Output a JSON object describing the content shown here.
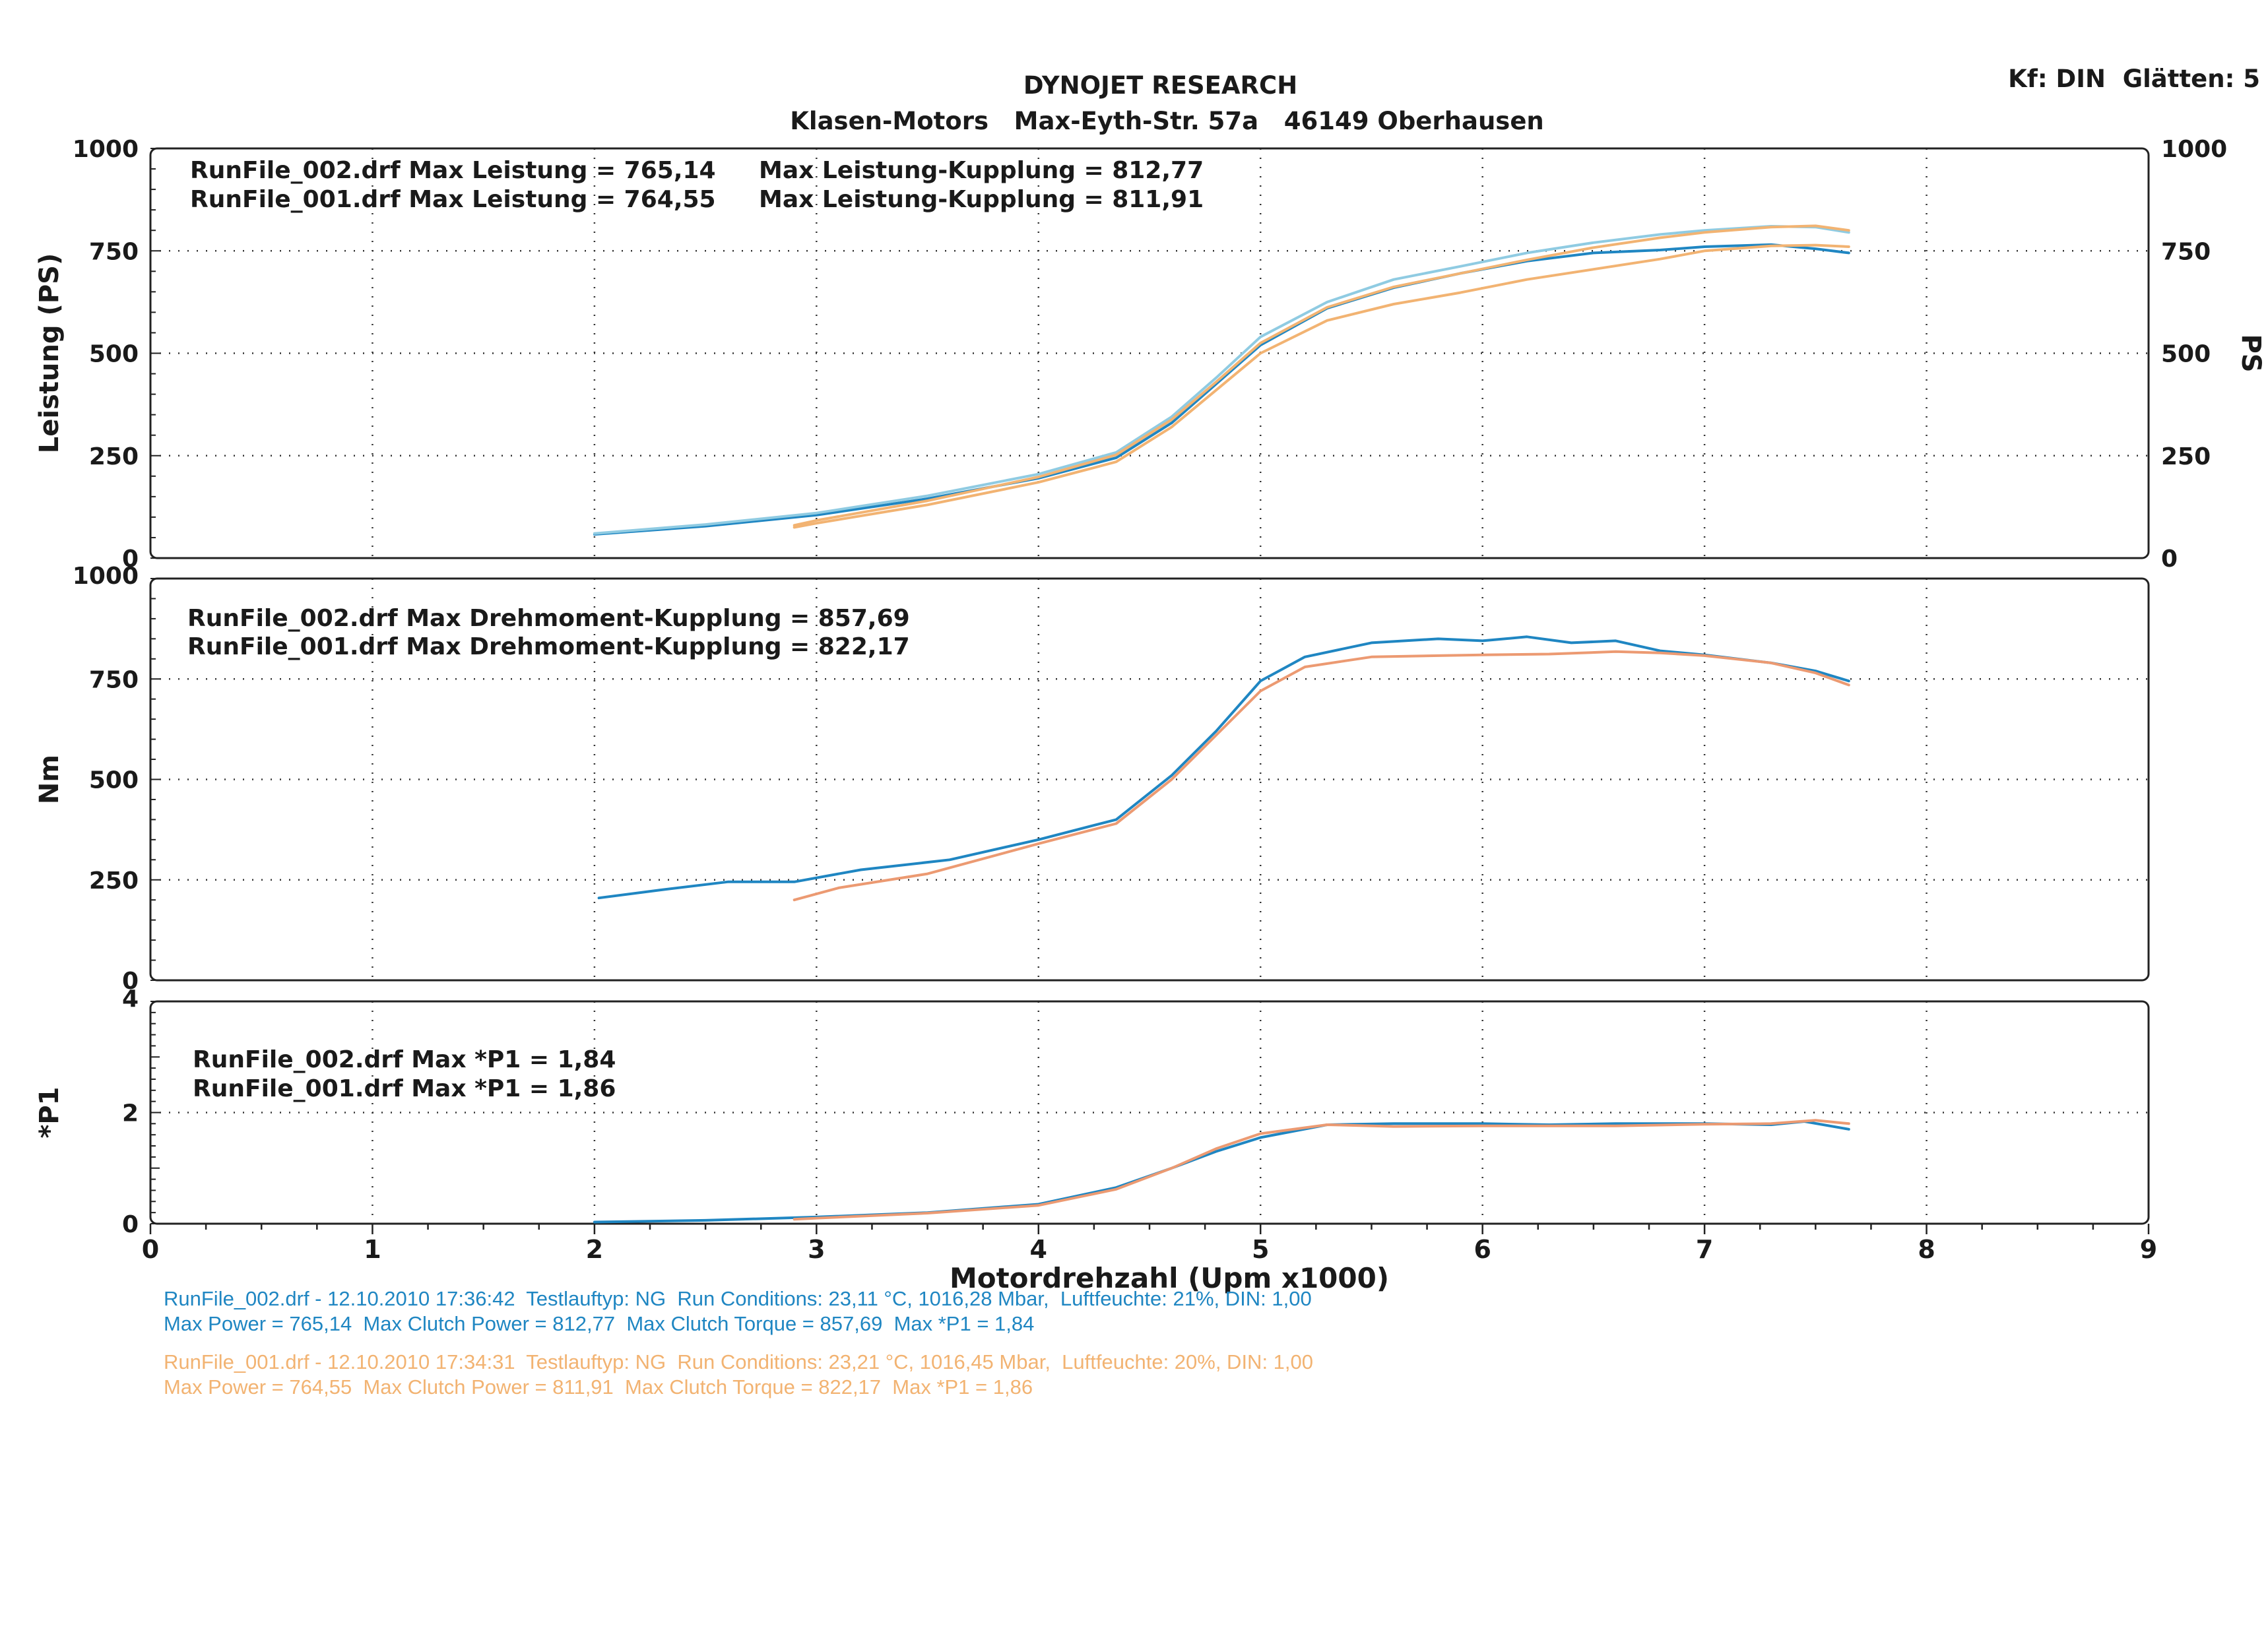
{
  "header": {
    "title": "DYNOJET RESEARCH",
    "subtitle": "Klasen-Motors   Max-Eyth-Str. 57a   46149 Oberhausen",
    "settings": "Kf: DIN  Glätten: 5"
  },
  "colors": {
    "run002": "#1f86c2",
    "run002_light": "#8fcbe2",
    "run001": "#f2b372",
    "run001_torque": "#ec9a72",
    "grid": "#333333",
    "frame": "#222222"
  },
  "chart_data": [
    {
      "type": "line",
      "panel": "power",
      "ylabel": "Leistung (PS)",
      "ylabel_right": "PS",
      "xlim": [
        0,
        9
      ],
      "ylim": [
        0,
        1000
      ],
      "yticks": [
        0,
        250,
        500,
        750,
        1000
      ],
      "grid": true,
      "annotations": [
        "RunFile_002.drf Max Leistung = 765,14",
        "Max Leistung-Kupplung = 812,77",
        "RunFile_001.drf Max Leistung = 764,55",
        "Max Leistung-Kupplung = 811,91"
      ],
      "series": [
        {
          "name": "RunFile_002.drf Leistung",
          "color_key": "run002",
          "points": [
            [
              2.0,
              58
            ],
            [
              2.5,
              78
            ],
            [
              3.0,
              105
            ],
            [
              3.5,
              145
            ],
            [
              4.0,
              195
            ],
            [
              4.35,
              245
            ],
            [
              4.6,
              330
            ],
            [
              4.8,
              425
            ],
            [
              5.0,
              520
            ],
            [
              5.3,
              610
            ],
            [
              5.6,
              660
            ],
            [
              5.9,
              695
            ],
            [
              6.2,
              725
            ],
            [
              6.5,
              745
            ],
            [
              6.8,
              752
            ],
            [
              7.0,
              760
            ],
            [
              7.3,
              765
            ],
            [
              7.5,
              755
            ],
            [
              7.65,
              745
            ]
          ]
        },
        {
          "name": "RunFile_002.drf Leistung-Kupplung",
          "color_key": "run002_light",
          "points": [
            [
              2.0,
              60
            ],
            [
              2.5,
              82
            ],
            [
              3.0,
              110
            ],
            [
              3.5,
              152
            ],
            [
              4.0,
              205
            ],
            [
              4.35,
              258
            ],
            [
              4.6,
              345
            ],
            [
              4.8,
              440
            ],
            [
              5.0,
              540
            ],
            [
              5.3,
              625
            ],
            [
              5.6,
              680
            ],
            [
              5.9,
              712
            ],
            [
              6.2,
              745
            ],
            [
              6.5,
              770
            ],
            [
              6.8,
              790
            ],
            [
              7.0,
              800
            ],
            [
              7.3,
              810
            ],
            [
              7.5,
              808
            ],
            [
              7.65,
              795
            ]
          ]
        },
        {
          "name": "RunFile_001.drf Leistung",
          "color_key": "run001",
          "points": [
            [
              2.9,
              75
            ],
            [
              3.0,
              85
            ],
            [
              3.5,
              130
            ],
            [
              4.0,
              185
            ],
            [
              4.35,
              235
            ],
            [
              4.6,
              320
            ],
            [
              4.8,
              410
            ],
            [
              5.0,
              500
            ],
            [
              5.3,
              580
            ],
            [
              5.6,
              620
            ],
            [
              5.9,
              648
            ],
            [
              6.2,
              680
            ],
            [
              6.5,
              705
            ],
            [
              6.8,
              730
            ],
            [
              7.0,
              750
            ],
            [
              7.3,
              762
            ],
            [
              7.5,
              764
            ],
            [
              7.65,
              760
            ]
          ]
        },
        {
          "name": "RunFile_001.drf Leistung-Kupplung",
          "color_key": "run001",
          "points": [
            [
              2.9,
              80
            ],
            [
              3.0,
              92
            ],
            [
              3.5,
              140
            ],
            [
              4.0,
              198
            ],
            [
              4.35,
              252
            ],
            [
              4.6,
              338
            ],
            [
              4.8,
              430
            ],
            [
              5.0,
              525
            ],
            [
              5.3,
              612
            ],
            [
              5.6,
              662
            ],
            [
              5.9,
              695
            ],
            [
              6.2,
              728
            ],
            [
              6.5,
              758
            ],
            [
              6.8,
              782
            ],
            [
              7.0,
              795
            ],
            [
              7.3,
              808
            ],
            [
              7.5,
              811
            ],
            [
              7.65,
              800
            ]
          ]
        }
      ]
    },
    {
      "type": "line",
      "panel": "torque",
      "ylabel": "Nm",
      "xlim": [
        0,
        9
      ],
      "ylim": [
        0,
        1000
      ],
      "yticks": [
        0,
        250,
        500,
        750,
        1000
      ],
      "grid": true,
      "annotations": [
        "RunFile_002.drf Max Drehmoment-Kupplung = 857,69",
        "RunFile_001.drf Max Drehmoment-Kupplung = 822,17"
      ],
      "series": [
        {
          "name": "RunFile_002.drf Drehmoment-Kupplung",
          "color_key": "run002",
          "points": [
            [
              2.02,
              205
            ],
            [
              2.3,
              225
            ],
            [
              2.6,
              245
            ],
            [
              2.9,
              245
            ],
            [
              3.2,
              275
            ],
            [
              3.6,
              300
            ],
            [
              4.0,
              350
            ],
            [
              4.35,
              400
            ],
            [
              4.6,
              510
            ],
            [
              4.8,
              620
            ],
            [
              5.0,
              745
            ],
            [
              5.2,
              805
            ],
            [
              5.5,
              840
            ],
            [
              5.8,
              850
            ],
            [
              6.0,
              845
            ],
            [
              6.2,
              855
            ],
            [
              6.4,
              840
            ],
            [
              6.6,
              845
            ],
            [
              6.8,
              820
            ],
            [
              7.0,
              810
            ],
            [
              7.3,
              790
            ],
            [
              7.5,
              770
            ],
            [
              7.65,
              745
            ]
          ]
        },
        {
          "name": "RunFile_001.drf Drehmoment-Kupplung",
          "color_key": "run001_torque",
          "points": [
            [
              2.9,
              200
            ],
            [
              3.1,
              230
            ],
            [
              3.5,
              265
            ],
            [
              4.0,
              340
            ],
            [
              4.35,
              390
            ],
            [
              4.6,
              500
            ],
            [
              4.8,
              610
            ],
            [
              5.0,
              720
            ],
            [
              5.2,
              780
            ],
            [
              5.5,
              805
            ],
            [
              5.8,
              808
            ],
            [
              6.0,
              810
            ],
            [
              6.3,
              812
            ],
            [
              6.6,
              818
            ],
            [
              6.8,
              815
            ],
            [
              7.0,
              808
            ],
            [
              7.3,
              790
            ],
            [
              7.5,
              765
            ],
            [
              7.65,
              735
            ]
          ]
        }
      ]
    },
    {
      "type": "line",
      "panel": "p1",
      "ylabel": "*P1",
      "xlabel": "Motordrehzahl (Upm x1000)",
      "xlim": [
        0,
        9
      ],
      "ylim": [
        0,
        4
      ],
      "yticks": [
        0,
        2,
        4
      ],
      "xticks": [
        0,
        1,
        2,
        3,
        4,
        5,
        6,
        7,
        8,
        9
      ],
      "grid": true,
      "annotations": [
        "RunFile_002.drf Max *P1 = 1,84",
        "RunFile_001.drf Max *P1 = 1,86"
      ],
      "series": [
        {
          "name": "RunFile_002.drf *P1",
          "color_key": "run002",
          "points": [
            [
              2.0,
              0.03
            ],
            [
              2.5,
              0.06
            ],
            [
              3.0,
              0.12
            ],
            [
              3.5,
              0.2
            ],
            [
              4.0,
              0.35
            ],
            [
              4.35,
              0.65
            ],
            [
              4.6,
              1.0
            ],
            [
              4.8,
              1.3
            ],
            [
              5.0,
              1.55
            ],
            [
              5.3,
              1.78
            ],
            [
              5.6,
              1.8
            ],
            [
              6.0,
              1.8
            ],
            [
              6.3,
              1.78
            ],
            [
              6.6,
              1.8
            ],
            [
              7.0,
              1.8
            ],
            [
              7.3,
              1.78
            ],
            [
              7.45,
              1.84
            ],
            [
              7.65,
              1.7
            ]
          ]
        },
        {
          "name": "RunFile_001.drf *P1",
          "color_key": "run001_torque",
          "points": [
            [
              2.9,
              0.08
            ],
            [
              3.0,
              0.1
            ],
            [
              3.5,
              0.19
            ],
            [
              4.0,
              0.33
            ],
            [
              4.35,
              0.62
            ],
            [
              4.6,
              1.0
            ],
            [
              4.8,
              1.35
            ],
            [
              5.0,
              1.62
            ],
            [
              5.3,
              1.78
            ],
            [
              5.6,
              1.75
            ],
            [
              6.0,
              1.76
            ],
            [
              6.3,
              1.76
            ],
            [
              6.6,
              1.76
            ],
            [
              7.0,
              1.79
            ],
            [
              7.3,
              1.8
            ],
            [
              7.5,
              1.86
            ],
            [
              7.65,
              1.8
            ]
          ]
        }
      ]
    }
  ],
  "footer": {
    "run002_line1": "RunFile_002.drf - 12.10.2010 17:36:42  Testlauftyp: NG  Run Conditions: 23,11 °C, 1016,28 Mbar,  Luftfeuchte: 21%, DIN: 1,00",
    "run002_line2": "Max Power = 765,14  Max Clutch Power = 812,77  Max Clutch Torque = 857,69  Max *P1 = 1,84",
    "run001_line1": "RunFile_001.drf - 12.10.2010 17:34:31  Testlauftyp: NG  Run Conditions: 23,21 °C, 1016,45 Mbar,  Luftfeuchte: 20%, DIN: 1,00",
    "run001_line2": "Max Power = 764,55  Max Clutch Power = 811,91  Max Clutch Torque = 822,17  Max *P1 = 1,86"
  }
}
